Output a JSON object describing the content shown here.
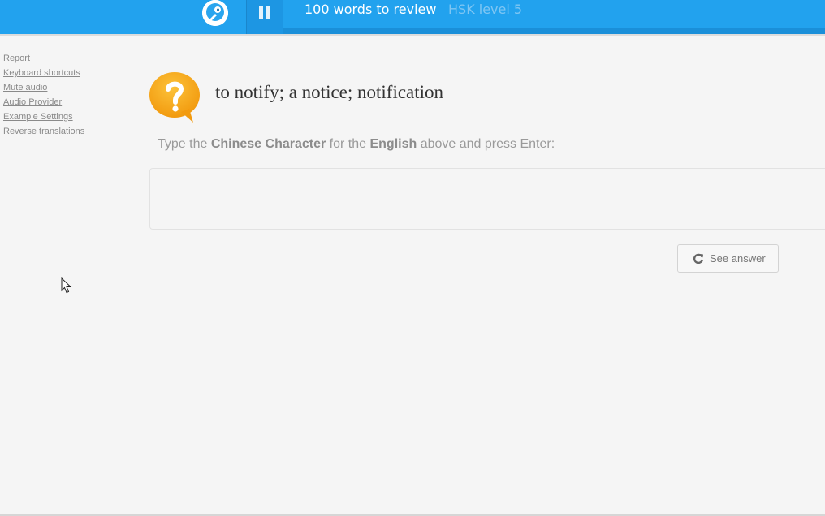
{
  "header": {
    "review_count": "100 words to review",
    "level": "HSK level 5",
    "logo_icon": "bird-logo-icon",
    "pause_icon": "pause-icon"
  },
  "sidebar": {
    "links": [
      {
        "label": "Report"
      },
      {
        "label": "Keyboard shortcuts"
      },
      {
        "label": "Mute audio"
      },
      {
        "label": "Audio Provider"
      },
      {
        "label": "Example Settings"
      },
      {
        "label": "Reverse translations"
      }
    ]
  },
  "question": {
    "icon": "question-bubble-icon",
    "prompt": "to notify; a notice; notification"
  },
  "instruction": {
    "part1": "Type the ",
    "bold1": "Chinese Character",
    "part2": " for the ",
    "bold2": "English",
    "part3": " above and press Enter:"
  },
  "answer": {
    "value": "",
    "placeholder": ""
  },
  "see_answer": {
    "label": "See answer",
    "icon": "refresh-icon"
  },
  "colors": {
    "header_blue": "#22a2ee",
    "icon_orange": "#f7a81b",
    "background": "#f5f5f5"
  }
}
